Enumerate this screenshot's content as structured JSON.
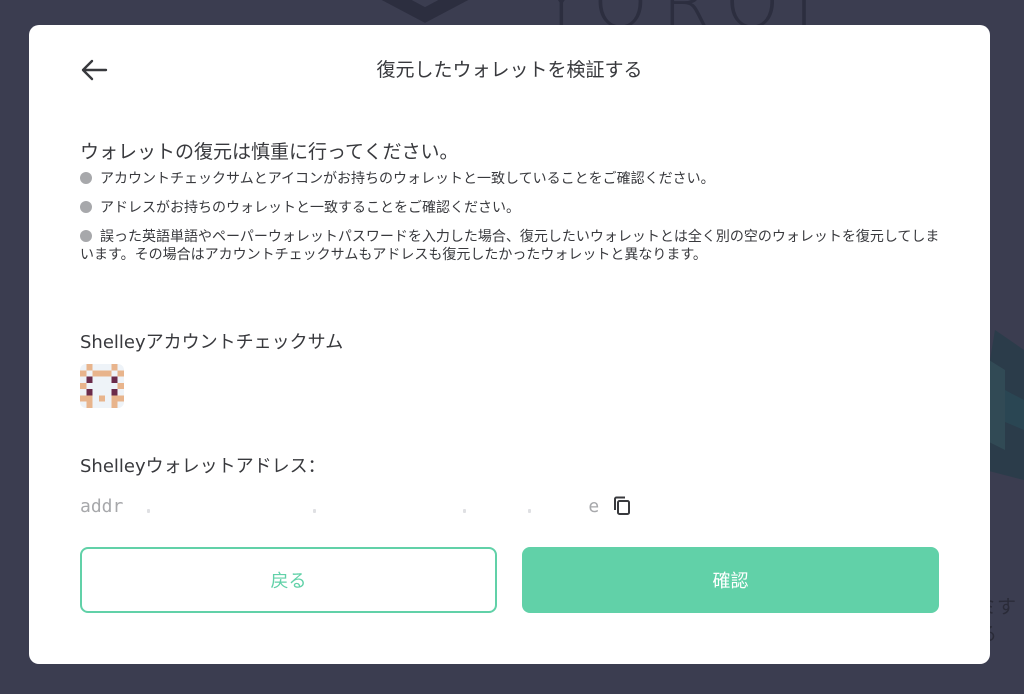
{
  "background": {
    "logo_text": "YOROI",
    "side_text": "ミする"
  },
  "modal": {
    "title": "復元したウォレットを検証する",
    "back_icon": "arrow-left-icon",
    "intro_heading": "ウォレットの復元は慎重に行ってください。",
    "bullets": [
      "アカウントチェックサムとアイコンがお持ちのウォレットと一致していることをご確認ください。",
      "アドレスがお持ちのウォレットと一致することをご確認ください。",
      "誤った英語単語やペーパーウォレットパスワードを入力した場合、復元したいウォレットとは全く別の空のウォレットを復元してしまいます。その場合はアカウントチェックサムもアドレスも復元したかったウォレットと異なります。"
    ],
    "checksum": {
      "label": "Shelleyアカウントチェックサム"
    },
    "address": {
      "label": "Shelleyウォレットアドレス：",
      "prefix": "addr",
      "suffix": "e",
      "copy_icon": "copy-icon"
    },
    "buttons": {
      "back_label": "戻る",
      "confirm_label": "確認"
    }
  },
  "colors": {
    "accent": "#61d1a8",
    "overlay": "#3b3d50",
    "text": "#38393d",
    "muted": "#a7a8ab"
  }
}
